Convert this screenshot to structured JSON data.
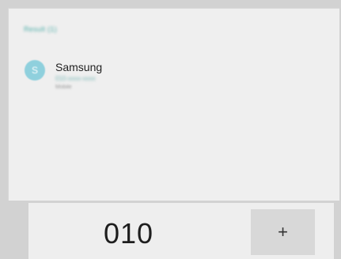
{
  "results": {
    "header": "Result (1)",
    "contacts": [
      {
        "avatar_initial": "S",
        "name": "Samsung",
        "number": "010-xxxx-xxxx",
        "type": "Mobile"
      }
    ]
  },
  "dialer": {
    "number": "010",
    "add_label": "+"
  },
  "colors": {
    "accent": "#3aa7a1",
    "avatar": "#8fd0dd",
    "panel": "#efefef",
    "frame": "#d2d2d2"
  }
}
